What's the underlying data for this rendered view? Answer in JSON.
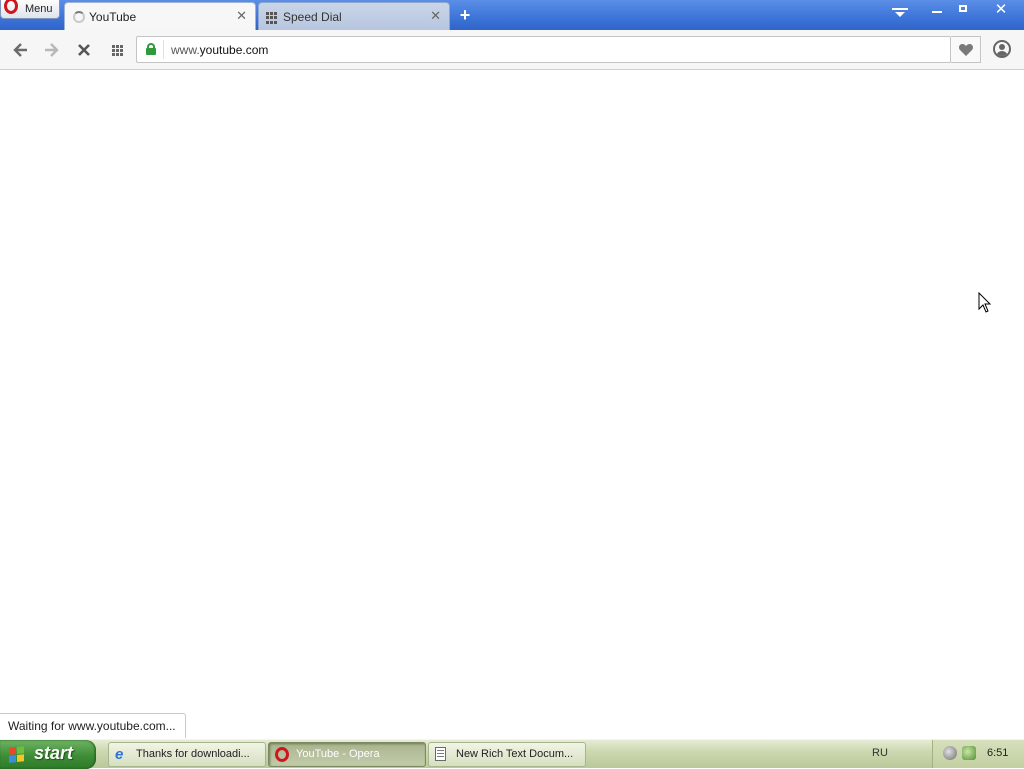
{
  "browser": {
    "menu_label": "Menu",
    "tabs": [
      {
        "title": "YouTube",
        "active": true,
        "icon": "loading-spinner-icon"
      },
      {
        "title": "Speed Dial",
        "active": false,
        "icon": "speed-dial-grid-icon"
      }
    ],
    "tab_close_glyph": "✕",
    "new_tab_glyph": "+",
    "window_close_glyph": "✕",
    "address": {
      "prefix": "www.",
      "domain": "youtube.com"
    },
    "status_text": "Waiting for www.youtube.com...",
    "accent_color": "#d0161d",
    "secure_color": "#2f9a3a"
  },
  "taskbar": {
    "start_label": "start",
    "tasks": [
      {
        "label": "Thanks for downloadi...",
        "icon": "internet-explorer-icon",
        "active": false
      },
      {
        "label": "YouTube - Opera",
        "icon": "opera-icon",
        "active": true
      },
      {
        "label": "New Rich Text Docum...",
        "icon": "document-icon",
        "active": false
      }
    ],
    "language": "RU",
    "clock": "6:51"
  }
}
